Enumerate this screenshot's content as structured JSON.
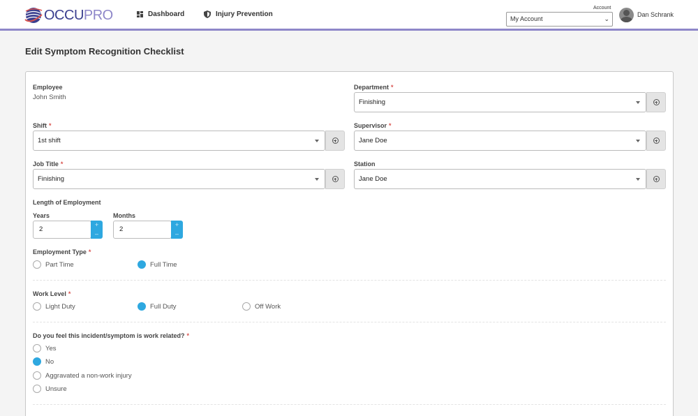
{
  "header": {
    "logo_occu": "OCCU",
    "logo_pro": "PRO",
    "nav": [
      {
        "label": "Dashboard",
        "icon": "dashboard-grid-icon"
      },
      {
        "label": "Injury Prevention",
        "icon": "shield-icon"
      }
    ],
    "account_label": "Account",
    "account_selected": "My Account",
    "user_name": "Dan Schrank"
  },
  "page": {
    "title": "Edit Symptom Recognition Checklist"
  },
  "form": {
    "employee": {
      "label": "Employee",
      "value": "John Smith"
    },
    "department": {
      "label": "Department",
      "value": "Finishing"
    },
    "shift": {
      "label": "Shift",
      "value": "1st shift"
    },
    "supervisor": {
      "label": "Supervisor",
      "value": "Jane Doe"
    },
    "job_title": {
      "label": "Job Title",
      "value": "Finishing"
    },
    "station": {
      "label": "Station",
      "value": "Jane Doe"
    },
    "length_of_employment": {
      "label": "Length of Employment",
      "years_label": "Years",
      "years_value": "2",
      "months_label": "Months",
      "months_value": "2"
    },
    "employment_type": {
      "label": "Employment Type",
      "options": [
        "Part Time",
        "Full Time"
      ],
      "selected": "Full Time"
    },
    "work_level": {
      "label": "Work Level",
      "options": [
        "Light Duty",
        "Full Duty",
        "Off Work"
      ],
      "selected": "Full Duty"
    },
    "work_related": {
      "label": "Do you feel this incident/symptom is work related?",
      "options": [
        "Yes",
        "No",
        "Aggravated a non-work injury",
        "Unsure"
      ],
      "selected": "No"
    },
    "required_mark": "*",
    "stepper_up": "+",
    "stepper_down": "–"
  },
  "colors": {
    "accent": "#2ea8e0",
    "brand_dark": "#3b3f8f",
    "brand_light": "#8e87c9",
    "required": "#d9534f"
  }
}
